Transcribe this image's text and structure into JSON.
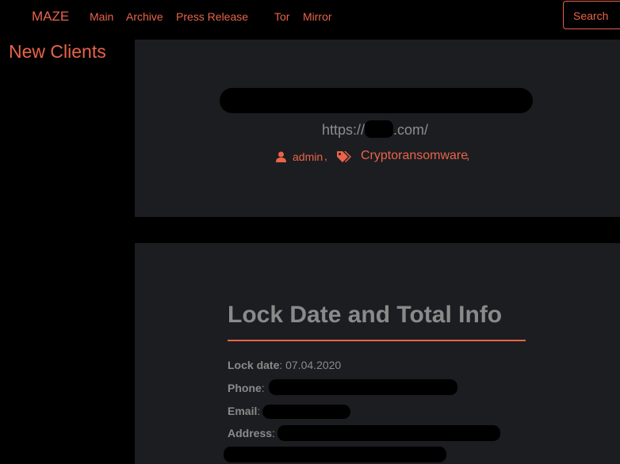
{
  "header": {
    "brand": "MAZE",
    "nav": [
      "Main",
      "Archive",
      "Press Release",
      "Tor",
      "Mirror"
    ],
    "search_label": "Search"
  },
  "sidebar": {
    "title": "New Clients"
  },
  "post": {
    "url_prefix": "https://",
    "url_suffix": ".com/",
    "author": "admin",
    "author_sep": ",",
    "tag": "Cryptoransomware",
    "tag_sep": ","
  },
  "details": {
    "heading": "Lock Date and Total Info",
    "lock_date_label": "Lock date",
    "lock_date_value": ": 07.04.2020",
    "phone_label": "Phone",
    "email_label": "Email",
    "address_label": "Address",
    "colon": ":"
  },
  "colors": {
    "accent": "#e8644a",
    "card_bg": "#1c1d20",
    "text_muted": "#8a8a8a"
  }
}
